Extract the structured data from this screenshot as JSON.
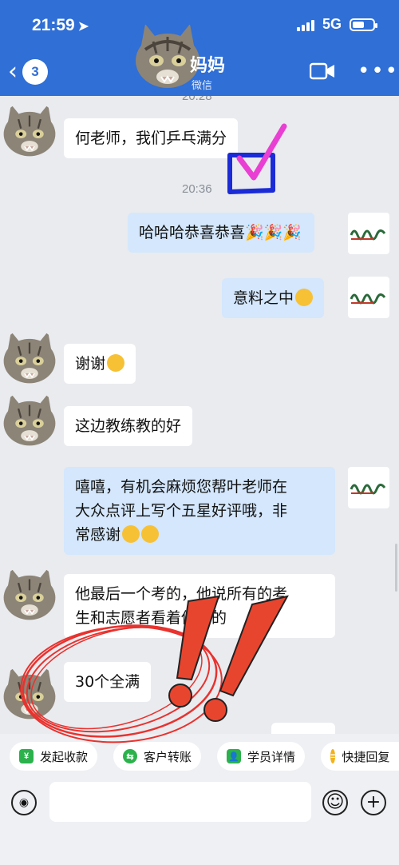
{
  "status": {
    "time": "21:59",
    "network": "5G"
  },
  "nav": {
    "unread_count": "3",
    "title": "妈妈",
    "subtitle": "微信"
  },
  "timestamps": [
    "20:28",
    "20:36"
  ],
  "messages": [
    {
      "side": "in",
      "text": "何老师，我们乒乓满分"
    },
    {
      "side": "out",
      "text": "哈哈哈恭喜恭喜"
    },
    {
      "side": "out",
      "text": "意料之中"
    },
    {
      "side": "in",
      "text": "谢谢"
    },
    {
      "side": "in",
      "text": "这边教练教的好"
    },
    {
      "side": "out",
      "text": [
        "嘻嘻，有机会麻烦您帮叶老师在",
        "大众点评上写个五星好评哦，非",
        "常感谢"
      ]
    },
    {
      "side": "in",
      "text": [
        "他最后一个考的，他说所有的考",
        "生和志愿者看着他考的"
      ]
    },
    {
      "side": "in",
      "text": "30个全满"
    }
  ],
  "quick_actions": [
    {
      "label": "发起收款",
      "icon": "yen-icon",
      "color": "#2bb24c"
    },
    {
      "label": "客户转账",
      "icon": "transfer-icon",
      "color": "#2bb24c"
    },
    {
      "label": "学员详情",
      "icon": "person-icon",
      "color": "#2bb24c"
    },
    {
      "label": "快捷回复",
      "icon": "reply-icon",
      "color": "#f2b21c"
    }
  ],
  "input": {
    "placeholder": ""
  },
  "colors": {
    "header": "#2f6fd6",
    "out_bubble": "#d4e7fc",
    "annotation_red": "#e8322e"
  }
}
